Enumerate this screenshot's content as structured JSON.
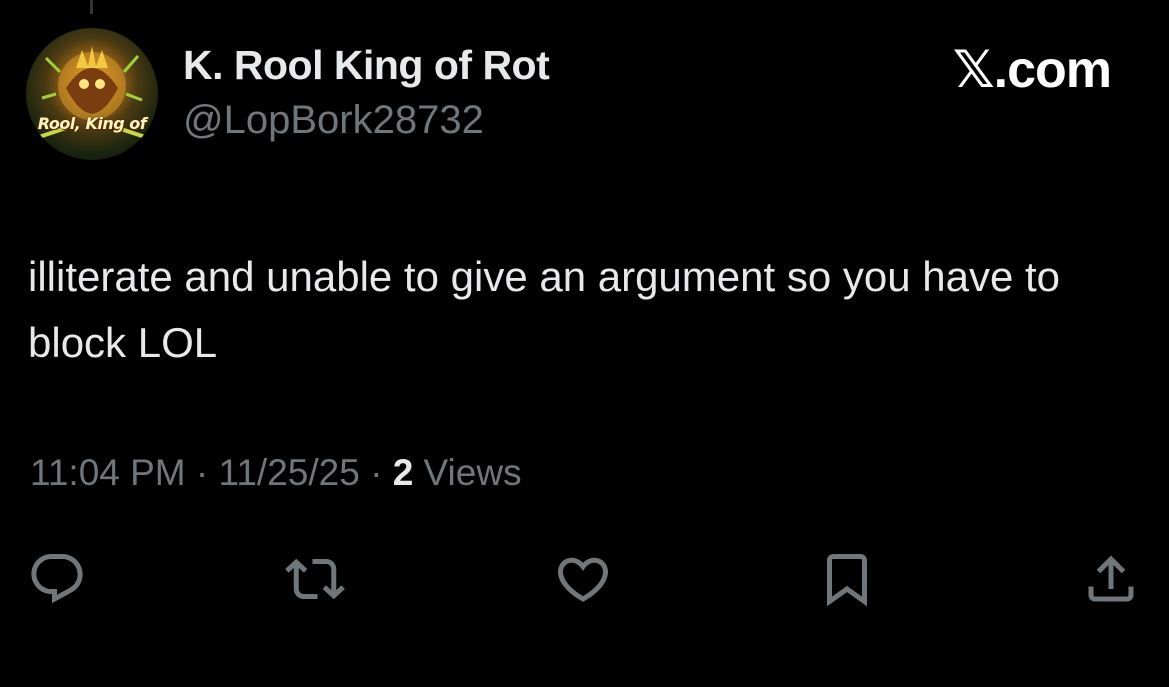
{
  "brand": "𝕏.com",
  "author": {
    "display_name": "K. Rool King of Rot",
    "handle": "@LopBork28732",
    "avatar_caption": "Rool, King of"
  },
  "tweet": {
    "text": "illiterate and unable to give an argument so you have to block LOL",
    "time": "11:04 PM",
    "date": "11/25/25",
    "separator": "·",
    "views_count": "2",
    "views_label": "Views"
  },
  "actions": [
    {
      "name": "reply",
      "icon": "reply-icon"
    },
    {
      "name": "repost",
      "icon": "repost-icon"
    },
    {
      "name": "like",
      "icon": "like-icon"
    },
    {
      "name": "bookmark",
      "icon": "bookmark-icon"
    },
    {
      "name": "share",
      "icon": "share-icon"
    }
  ],
  "colors": {
    "background": "#000000",
    "primary_text": "#e7e9ea",
    "secondary_text": "#71767b"
  }
}
